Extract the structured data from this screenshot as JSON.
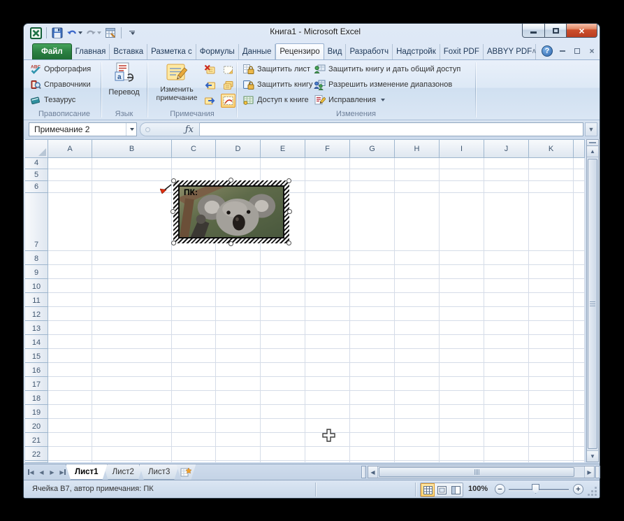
{
  "window": {
    "title": "Книга1 - Microsoft Excel"
  },
  "qat": {
    "icons": [
      "excel-logo",
      "save",
      "undo",
      "redo",
      "switch-windows",
      "customize-quick-access"
    ]
  },
  "tabs": [
    {
      "label": "Файл",
      "active": false
    },
    {
      "label": "Главная",
      "active": false
    },
    {
      "label": "Вставка",
      "active": false
    },
    {
      "label": "Разметка с",
      "active": false
    },
    {
      "label": "Формулы",
      "active": false
    },
    {
      "label": "Данные",
      "active": false
    },
    {
      "label": "Рецензиро",
      "active": true
    },
    {
      "label": "Вид",
      "active": false
    },
    {
      "label": "Разработч",
      "active": false
    },
    {
      "label": "Надстройк",
      "active": false
    },
    {
      "label": "Foxit PDF",
      "active": false
    },
    {
      "label": "ABBYY PDF",
      "active": false
    }
  ],
  "ribbon": {
    "proofing": {
      "label": "Правописание",
      "items": [
        "Орфография",
        "Справочники",
        "Тезаурус"
      ]
    },
    "language": {
      "label": "Язык",
      "button": "Перевод"
    },
    "comments": {
      "label": "Примечания",
      "edit_button": "Изменить примечание",
      "icons": [
        "delete-comment",
        "show-hide-comment",
        "previous-comment",
        "show-all-comments",
        "next-comment",
        "show-ink"
      ]
    },
    "changes": {
      "label": "Изменения",
      "items": [
        "Защитить лист",
        "Защитить книгу",
        "Доступ к книге",
        "Защитить книгу и дать общий доступ",
        "Разрешить изменение диапазонов",
        "Исправления"
      ]
    }
  },
  "formula_bar": {
    "name_box": "Примечание 2",
    "fx": "ƒx"
  },
  "grid": {
    "columns": [
      "A",
      "B",
      "C",
      "D",
      "E",
      "F",
      "G",
      "H",
      "I",
      "J",
      "K"
    ],
    "rows": [
      "4",
      "5",
      "6",
      "7",
      "8",
      "9",
      "10",
      "11",
      "12",
      "13",
      "14",
      "15",
      "16",
      "17",
      "18",
      "19",
      "20",
      "21",
      "22"
    ]
  },
  "comment": {
    "author_label": "ПК:"
  },
  "sheet_bar": {
    "sheets": [
      {
        "label": "Лист1",
        "active": true
      },
      {
        "label": "Лист2",
        "active": false
      },
      {
        "label": "Лист3",
        "active": false
      }
    ]
  },
  "status_bar": {
    "cell_info": "Ячейка B7, автор примечания: ПК",
    "zoom_level": "100%"
  },
  "colors": {
    "file_tab_green": "#2c8143",
    "note_yellow": "#ffe9a2",
    "close_red": "#cd4f2c",
    "highlight_orange": "#e09a30"
  }
}
